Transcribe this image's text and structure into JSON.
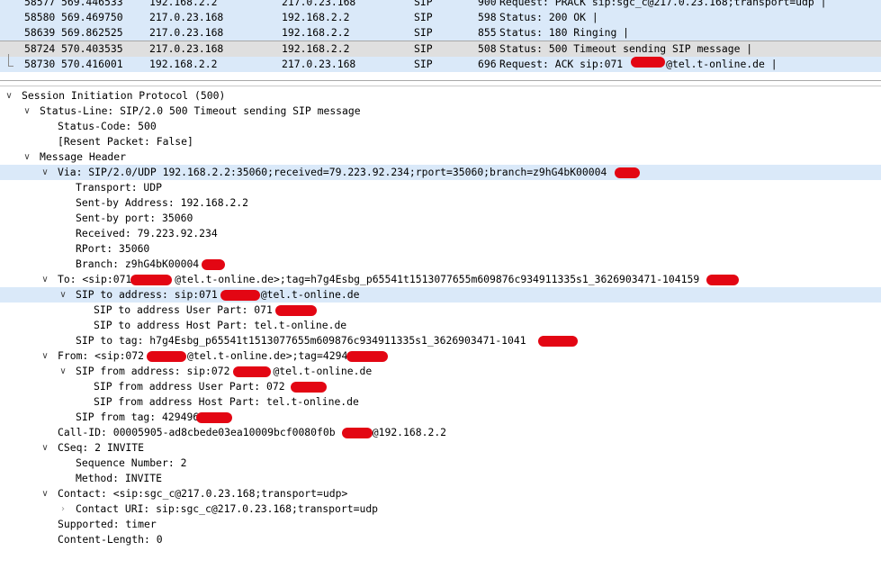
{
  "packet_list": {
    "rows": [
      {
        "no": "58577",
        "time": "569.446533",
        "src": "192.168.2.2",
        "dst": "217.0.23.168",
        "proto": "SIP",
        "len": "900",
        "info": "Request: PRACK sip:sgc_c@217.0.23.168;transport=udp |"
      },
      {
        "no": "58580",
        "time": "569.469750",
        "src": "217.0.23.168",
        "dst": "192.168.2.2",
        "proto": "SIP",
        "len": "598",
        "info": "Status: 200 OK |"
      },
      {
        "no": "58639",
        "time": "569.862525",
        "src": "217.0.23.168",
        "dst": "192.168.2.2",
        "proto": "SIP",
        "len": "855",
        "info": "Status: 180 Ringing |"
      },
      {
        "no": "58724",
        "time": "570.403535",
        "src": "217.0.23.168",
        "dst": "192.168.2.2",
        "proto": "SIP",
        "len": "508",
        "info": "Status: 500 Timeout sending SIP message |"
      },
      {
        "no": "58730",
        "time": "570.416001",
        "src": "192.168.2.2",
        "dst": "217.0.23.168",
        "proto": "SIP",
        "len": "696",
        "info": "Request: ACK sip:071       @tel.t-online.de |"
      }
    ]
  },
  "details": {
    "sip": "Session Initiation Protocol (500)",
    "status_line": "Status-Line: SIP/2.0 500 Timeout sending SIP message",
    "status_code": "Status-Code: 500",
    "resent": "[Resent Packet: False]",
    "msg_header": "Message Header",
    "via": "Via: SIP/2.0/UDP 192.168.2.2:35060;received=79.223.92.234;rport=35060;branch=z9hG4bK00004",
    "transport": "Transport: UDP",
    "sent_by_addr": "Sent-by Address: 192.168.2.2",
    "sent_by_port": "Sent-by port: 35060",
    "received": "Received: 79.223.92.234",
    "rport": "RPort: 35060",
    "branch": "Branch: z9hG4bK00004",
    "to": "To: <sip:071       @tel.t-online.de>;tag=h7g4Esbg_p65541t1513077655m609876c934911335s1_3626903471-104159",
    "to_addr": "SIP to address: sip:071       @tel.t-online.de",
    "to_user": "SIP to address User Part: 071",
    "to_host": "SIP to address Host Part: tel.t-online.de",
    "to_tag": "SIP to tag: h7g4Esbg_p65541t1513077655m609876c934911335s1_3626903471-1041",
    "from": "From: <sip:072       @tel.t-online.de>;tag=429496",
    "from_addr": "SIP from address: sip:072       @tel.t-online.de",
    "from_user": "SIP from address User Part: 072",
    "from_host": "SIP from address Host Part: tel.t-online.de",
    "from_tag": "SIP from tag: 429496",
    "call_id": "Call-ID: 00005905-ad8cbede03ea10009bcf0080f0b      @192.168.2.2",
    "cseq": "CSeq: 2 INVITE",
    "seq_num": "Sequence Number: 2",
    "method": "Method: INVITE",
    "contact": "Contact: <sip:sgc_c@217.0.23.168;transport=udp>",
    "contact_uri": "Contact URI: sip:sgc_c@217.0.23.168;transport=udp",
    "supported": "Supported: timer",
    "content_length": "Content-Length: 0"
  },
  "colors": {
    "selected_row": "#dae9f9",
    "current_row": "#dfdfdf",
    "redaction": "#e30613"
  },
  "icons": {
    "expanded": "chevron-down-icon",
    "collapsed": "chevron-right-icon"
  }
}
